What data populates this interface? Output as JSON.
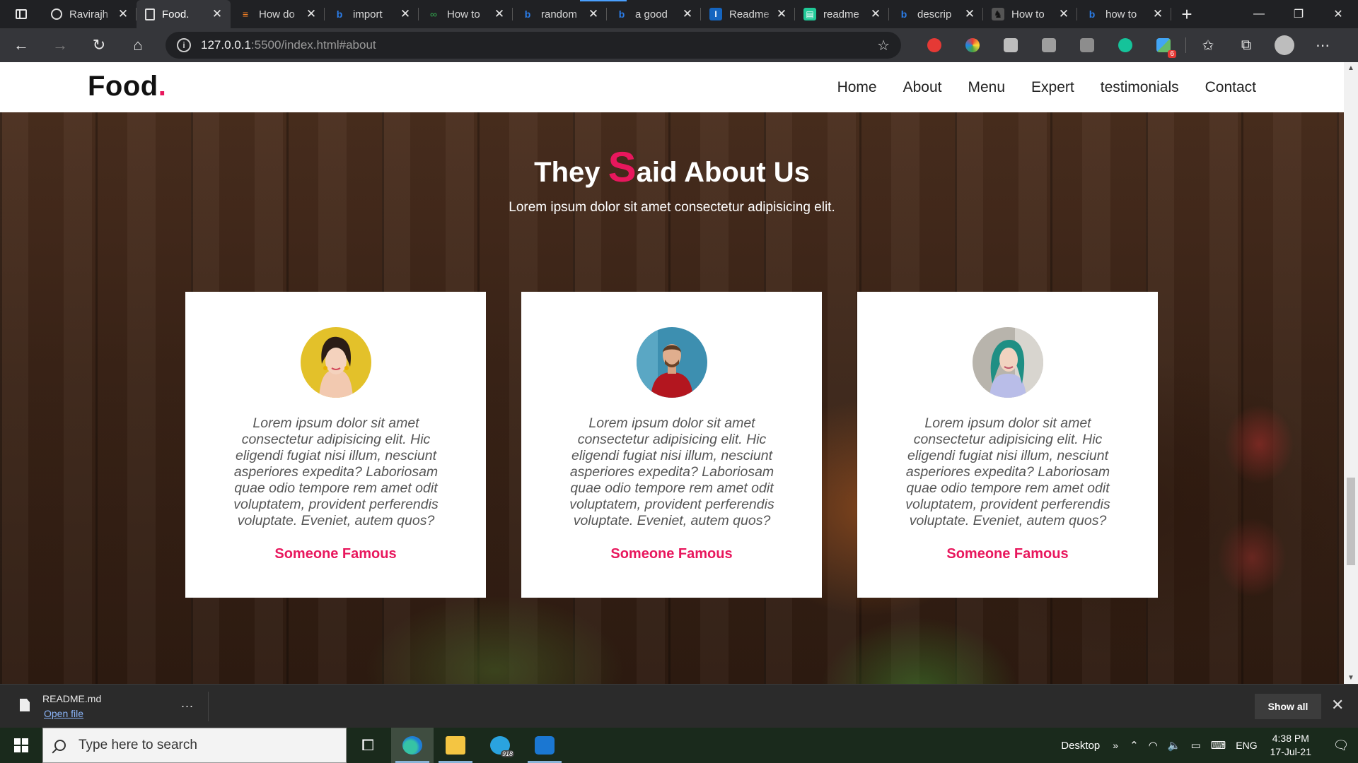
{
  "browser": {
    "tabs": [
      {
        "label": "Ravirajh",
        "favicon": "github-icon",
        "color": "#ffffff",
        "active": false
      },
      {
        "label": "Food.",
        "favicon": "page-icon",
        "color": "#ffffff",
        "active": true
      },
      {
        "label": "How do",
        "favicon": "stackoverflow-icon",
        "color": "#f48024",
        "active": false
      },
      {
        "label": "import",
        "favicon": "bing-icon",
        "color": "#2b7de9",
        "active": false
      },
      {
        "label": "How to",
        "favicon": "gfg-icon",
        "color": "#2f8d46",
        "active": false
      },
      {
        "label": "random",
        "favicon": "bing-icon",
        "color": "#2b7de9",
        "active": false
      },
      {
        "label": "a good",
        "favicon": "bing-icon",
        "color": "#2b7de9",
        "active": false
      },
      {
        "label": "Readme",
        "favicon": "i-icon",
        "color": "#1565c0",
        "active": false
      },
      {
        "label": "readme",
        "favicon": "green-doc-icon",
        "color": "#20c997",
        "active": false
      },
      {
        "label": "descrip",
        "favicon": "bing-icon",
        "color": "#2b7de9",
        "active": false
      },
      {
        "label": "How to",
        "favicon": "horse-icon",
        "color": "#111111",
        "active": false
      },
      {
        "label": "how to",
        "favicon": "bing-icon",
        "color": "#2b7de9",
        "active": false
      }
    ],
    "address": {
      "host": "127.0.0.1",
      "path": ":5500/index.html#about"
    },
    "extension_badge": "6"
  },
  "site": {
    "logo": {
      "text": "Food",
      "dot": "."
    },
    "nav": [
      "Home",
      "About",
      "Menu",
      "Expert",
      "testimonials",
      "Contact"
    ],
    "accent": "#e8175d"
  },
  "testimonials": {
    "title_prefix": "They ",
    "title_big_letter": "S",
    "title_rest": "aid About Us",
    "subtitle": "Lorem ipsum dolor sit amet consectetur adipisicing elit.",
    "cards": [
      {
        "quote": "Lorem ipsum dolor sit amet consectetur adipisicing elit. Hic eligendi fugiat nisi illum, nesciunt asperiores expedita? Laboriosam quae odio tempore rem amet odit voluptatem, provident perferendis voluptate. Eveniet, autem quos?",
        "author": "Someone Famous",
        "photo": "woman-yellow-background-avatar"
      },
      {
        "quote": "Lorem ipsum dolor sit amet consectetur adipisicing elit. Hic eligendi fugiat nisi illum, nesciunt asperiores expedita? Laboriosam quae odio tempore rem amet odit voluptatem, provident perferendis voluptate. Eveniet, autem quos?",
        "author": "Someone Famous",
        "photo": "man-red-shirt-avatar"
      },
      {
        "quote": "Lorem ipsum dolor sit amet consectetur adipisicing elit. Hic eligendi fugiat nisi illum, nesciunt asperiores expedita? Laboriosam quae odio tempore rem amet odit voluptatem, provident perferendis voluptate. Eveniet, autem quos?",
        "author": "Someone Famous",
        "photo": "woman-green-hair-avatar"
      }
    ]
  },
  "download_shelf": {
    "filename": "README.md",
    "open_label": "Open file",
    "more_label": "...",
    "show_all_label": "Show all"
  },
  "taskbar": {
    "search_placeholder": "Type here to search",
    "telegram_count": "918",
    "desktop_label": "Desktop",
    "overflow_label": "»",
    "language": "ENG",
    "time": "4:38 PM",
    "date": "17-Jul-21"
  }
}
